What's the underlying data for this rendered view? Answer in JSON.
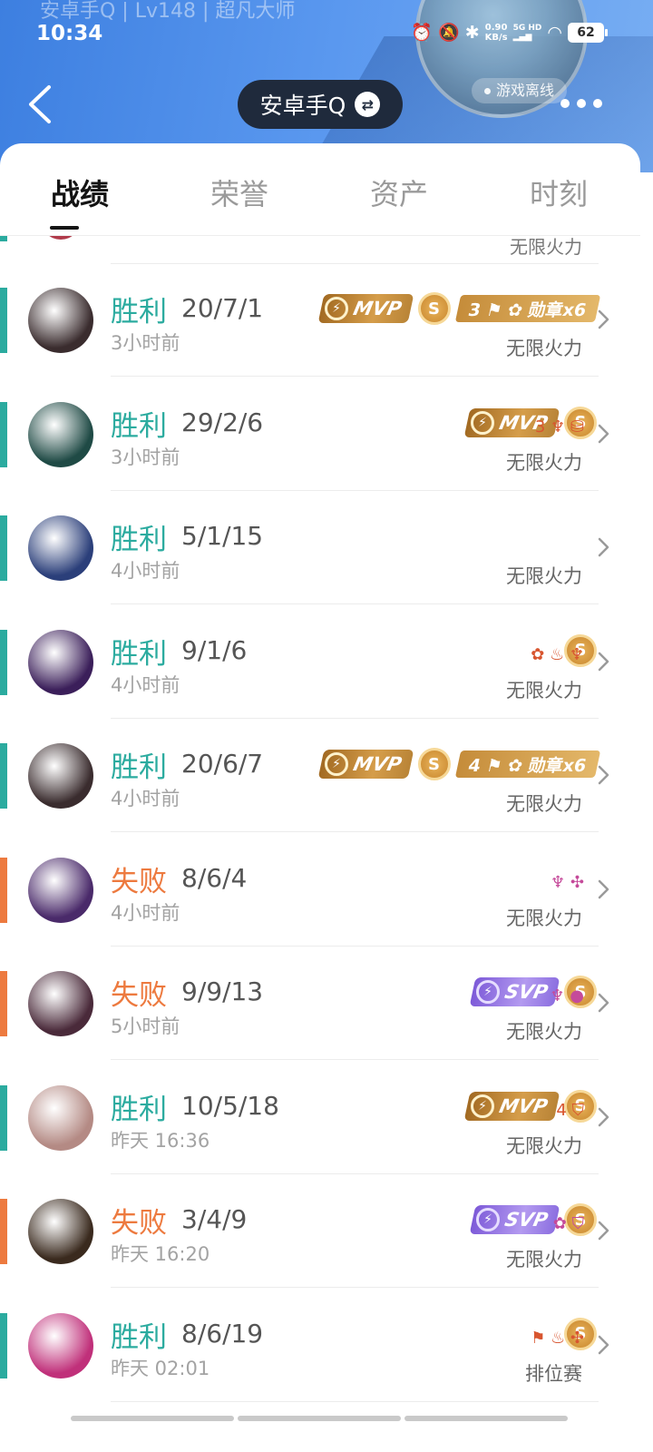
{
  "status_bar": {
    "ghost_title": "安卓手Q | Lv148 | 超凡大师",
    "time": "10:34",
    "net_speed": "0.90",
    "net_unit": "KB/s",
    "signal_label": "5G HD",
    "battery": "62"
  },
  "header": {
    "account_name": "安卓手Q",
    "status_label": "游戏离线"
  },
  "tabs": [
    "战绩",
    "荣誉",
    "资产",
    "时刻"
  ],
  "top_partial_mode": "无限火力",
  "matches": [
    {
      "result": "胜利",
      "outcome": "win",
      "kda": "20/7/1",
      "time": "3小时前",
      "mode": "无限火力",
      "badge": "MVP",
      "badge_type": "mvp",
      "coin": "S",
      "medal": "3 ⚑ ✿ 勋章x6",
      "mini": "",
      "avatar_color": "#3a2c2e"
    },
    {
      "result": "胜利",
      "outcome": "win",
      "kda": "29/2/6",
      "time": "3小时前",
      "mode": "无限火力",
      "badge": "MVP",
      "badge_type": "mvp",
      "coin": "S",
      "medal": "",
      "mini": "3 ♆ ⛁",
      "avatar_color": "#1f4a45"
    },
    {
      "result": "胜利",
      "outcome": "win",
      "kda": "5/1/15",
      "time": "4小时前",
      "mode": "无限火力",
      "badge": "",
      "badge_type": "",
      "coin": "",
      "medal": "",
      "mini": "",
      "avatar_color": "#2b3f7a"
    },
    {
      "result": "胜利",
      "outcome": "win",
      "kda": "9/1/6",
      "time": "4小时前",
      "mode": "无限火力",
      "badge": "",
      "badge_type": "",
      "coin": "S",
      "medal": "",
      "mini": "✿ ♨ ♆",
      "avatar_color": "#3b1f5a"
    },
    {
      "result": "胜利",
      "outcome": "win",
      "kda": "20/6/7",
      "time": "4小时前",
      "mode": "无限火力",
      "badge": "MVP",
      "badge_type": "mvp",
      "coin": "S",
      "medal": "4 ⚑ ✿ 勋章x6",
      "mini": "",
      "avatar_color": "#3a2c2e"
    },
    {
      "result": "失败",
      "outcome": "loss",
      "kda": "8/6/4",
      "time": "4小时前",
      "mode": "无限火力",
      "badge": "",
      "badge_type": "",
      "coin": "",
      "medal": "",
      "mini": "♆ ✣",
      "avatar_color": "#4a2a6a"
    },
    {
      "result": "失败",
      "outcome": "loss",
      "kda": "9/9/13",
      "time": "5小时前",
      "mode": "无限火力",
      "badge": "SVP",
      "badge_type": "svp",
      "coin": "S",
      "medal": "",
      "mini": "♆ ●",
      "avatar_color": "#4a2a3a"
    },
    {
      "result": "胜利",
      "outcome": "win",
      "kda": "10/5/18",
      "time": "昨天 16:36",
      "mode": "无限火力",
      "badge": "MVP",
      "badge_type": "mvp",
      "coin": "S",
      "medal": "",
      "mini": "4 ⛉",
      "avatar_color": "#b48a84"
    },
    {
      "result": "失败",
      "outcome": "loss",
      "kda": "3/4/9",
      "time": "昨天 16:20",
      "mode": "无限火力",
      "badge": "SVP",
      "badge_type": "svp",
      "coin": "S",
      "medal": "",
      "mini": "✿ ⛉",
      "avatar_color": "#3a2a1e"
    },
    {
      "result": "胜利",
      "outcome": "win",
      "kda": "8/6/19",
      "time": "昨天 02:01",
      "mode": "排位赛",
      "badge": "",
      "badge_type": "",
      "coin": "S",
      "medal": "",
      "mini": "⚑ ♨ ✣",
      "avatar_color": "#c0307a"
    }
  ],
  "colors": {
    "win": "#2bab9f",
    "loss": "#ed7a3f",
    "header_blue": "#4a8be6"
  }
}
